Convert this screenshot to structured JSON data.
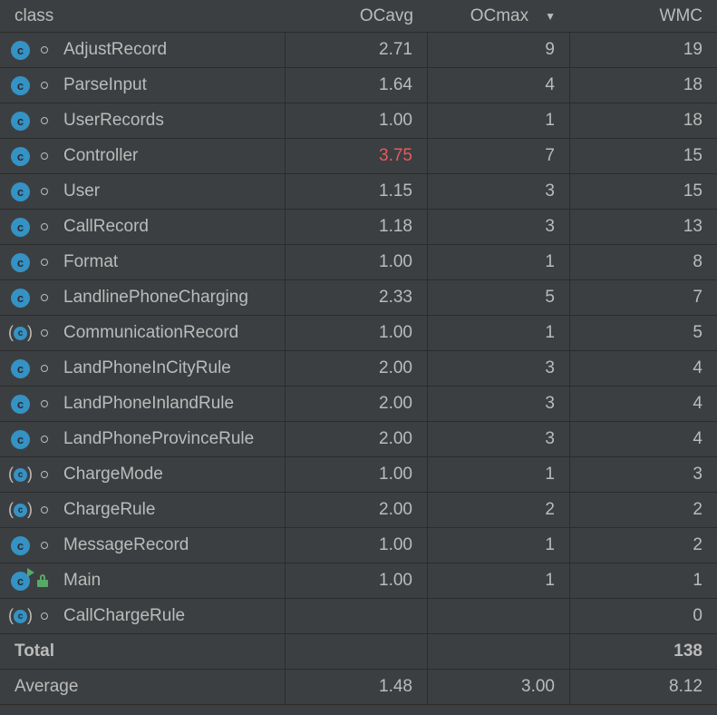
{
  "columns": {
    "class": "class",
    "ocavg": "OCavg",
    "ocmax": "OCmax",
    "wmc": "WMC"
  },
  "rows": [
    {
      "name": "AdjustRecord",
      "ocavg": "2.71",
      "ocmax": "9",
      "wmc": "19",
      "icon": "class-icon"
    },
    {
      "name": "ParseInput",
      "ocavg": "1.64",
      "ocmax": "4",
      "wmc": "18",
      "icon": "class-icon"
    },
    {
      "name": "UserRecords",
      "ocavg": "1.00",
      "ocmax": "1",
      "wmc": "18",
      "icon": "class-icon"
    },
    {
      "name": "Controller",
      "ocavg": "3.75",
      "ocmax": "7",
      "wmc": "15",
      "icon": "class-icon",
      "highlight": "#e9595c"
    },
    {
      "name": "User",
      "ocavg": "1.15",
      "ocmax": "3",
      "wmc": "15",
      "icon": "class-icon"
    },
    {
      "name": "CallRecord",
      "ocavg": "1.18",
      "ocmax": "3",
      "wmc": "13",
      "icon": "class-icon"
    },
    {
      "name": "Format",
      "ocavg": "1.00",
      "ocmax": "1",
      "wmc": "8",
      "icon": "class-icon"
    },
    {
      "name": "LandlinePhoneCharging",
      "ocavg": "2.33",
      "ocmax": "5",
      "wmc": "7",
      "icon": "class-icon"
    },
    {
      "name": "CommunicationRecord",
      "ocavg": "1.00",
      "ocmax": "1",
      "wmc": "5",
      "icon": "abstract-class-icon"
    },
    {
      "name": "LandPhoneInCityRule",
      "ocavg": "2.00",
      "ocmax": "3",
      "wmc": "4",
      "icon": "class-icon"
    },
    {
      "name": "LandPhoneInlandRule",
      "ocavg": "2.00",
      "ocmax": "3",
      "wmc": "4",
      "icon": "class-icon"
    },
    {
      "name": "LandPhoneProvinceRule",
      "ocavg": "2.00",
      "ocmax": "3",
      "wmc": "4",
      "icon": "class-icon"
    },
    {
      "name": "ChargeMode",
      "ocavg": "1.00",
      "ocmax": "1",
      "wmc": "3",
      "icon": "abstract-class-icon"
    },
    {
      "name": "ChargeRule",
      "ocavg": "2.00",
      "ocmax": "2",
      "wmc": "2",
      "icon": "abstract-class-icon"
    },
    {
      "name": "MessageRecord",
      "ocavg": "1.00",
      "ocmax": "1",
      "wmc": "2",
      "icon": "class-icon"
    },
    {
      "name": "Main",
      "ocavg": "1.00",
      "ocmax": "1",
      "wmc": "1",
      "icon": "runnable-class-icon"
    },
    {
      "name": "CallChargeRule",
      "ocavg": "",
      "ocmax": "",
      "wmc": "0",
      "icon": "abstract-class-icon"
    }
  ],
  "total": {
    "label": "Total",
    "ocavg": "",
    "ocmax": "",
    "wmc": "138"
  },
  "average": {
    "label": "Average",
    "ocavg": "1.48",
    "ocmax": "3.00",
    "wmc": "8.12"
  },
  "icon_glyph": "c",
  "colors": {
    "class_icon": "#3592c4",
    "highlight": "#e9595c",
    "public_lock": "#59a869"
  }
}
